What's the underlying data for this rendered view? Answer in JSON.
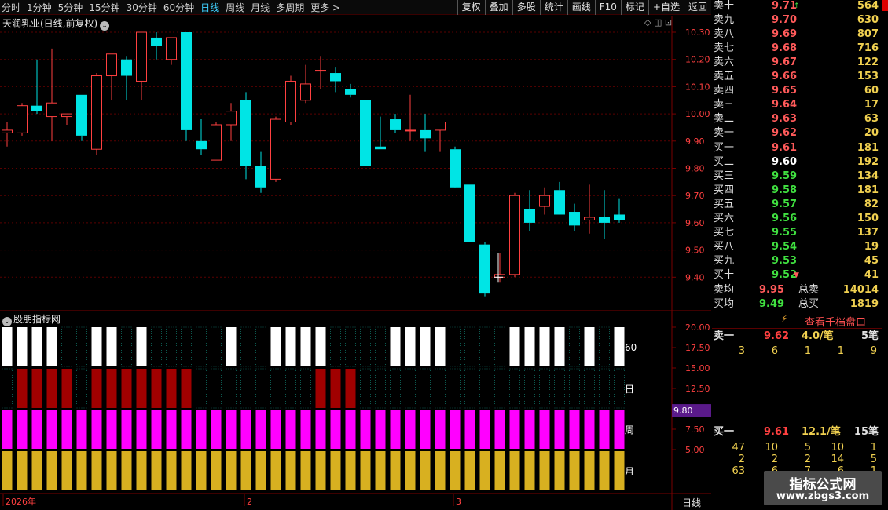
{
  "toolbar": {
    "periods": [
      "分时",
      "1分钟",
      "5分钟",
      "15分钟",
      "30分钟",
      "60分钟",
      "日线",
      "周线",
      "月线",
      "多周期",
      "更多 >"
    ],
    "active": "日线",
    "actions": [
      "复权",
      "叠加",
      "多股",
      "统计",
      "画线",
      "F10",
      "标记",
      "+自选",
      "返回"
    ]
  },
  "main_chart": {
    "title": "天润乳业(日线,前复权)",
    "tools": "◇ ◫ ⊡",
    "y_ticks": [
      "10.30",
      "10.20",
      "10.10",
      "10.00",
      "9.90",
      "9.80",
      "9.70",
      "9.60",
      "9.50",
      "9.40"
    ]
  },
  "indicator": {
    "title": "股朋指标网",
    "y_ticks": [
      "20.00",
      "17.50",
      "15.00",
      "12.50",
      "10.00",
      "7.50",
      "5.00"
    ],
    "row_labels": [
      "60",
      "日",
      "周",
      "月"
    ],
    "current_value": "9.80",
    "bottom_axis_label": "日线",
    "date_labels": [
      "2026年",
      "2",
      "3"
    ]
  },
  "chart_data": {
    "type": "candlestick",
    "title": "天润乳业(日线,前复权)",
    "ylim": [
      9.33,
      10.35
    ],
    "candles": [
      {
        "o": 9.93,
        "h": 9.97,
        "l": 9.88,
        "c": 9.94
      },
      {
        "o": 9.93,
        "h": 10.04,
        "l": 9.92,
        "c": 10.03
      },
      {
        "o": 10.03,
        "h": 10.2,
        "l": 10.0,
        "c": 10.01
      },
      {
        "o": 9.99,
        "h": 10.24,
        "l": 9.9,
        "c": 10.04
      },
      {
        "o": 9.99,
        "h": 10.0,
        "l": 9.96,
        "c": 10.0
      },
      {
        "o": 10.07,
        "h": 10.07,
        "l": 9.9,
        "c": 9.92
      },
      {
        "o": 9.87,
        "h": 10.15,
        "l": 9.85,
        "c": 10.14
      },
      {
        "o": 10.14,
        "h": 10.22,
        "l": 10.05,
        "c": 10.22
      },
      {
        "o": 10.2,
        "h": 10.21,
        "l": 10.05,
        "c": 10.14
      },
      {
        "o": 10.12,
        "h": 10.3,
        "l": 10.05,
        "c": 10.3
      },
      {
        "o": 10.28,
        "h": 10.3,
        "l": 10.2,
        "c": 10.25
      },
      {
        "o": 10.2,
        "h": 10.28,
        "l": 10.18,
        "c": 10.28
      },
      {
        "o": 10.3,
        "h": 10.3,
        "l": 9.9,
        "c": 9.94
      },
      {
        "o": 9.9,
        "h": 9.98,
        "l": 9.85,
        "c": 9.87
      },
      {
        "o": 9.83,
        "h": 9.97,
        "l": 9.83,
        "c": 9.96
      },
      {
        "o": 9.96,
        "h": 10.04,
        "l": 9.9,
        "c": 10.01
      },
      {
        "o": 10.05,
        "h": 10.08,
        "l": 9.76,
        "c": 9.81
      },
      {
        "o": 9.81,
        "h": 9.86,
        "l": 9.71,
        "c": 9.73
      },
      {
        "o": 9.76,
        "h": 9.99,
        "l": 9.75,
        "c": 9.98
      },
      {
        "o": 9.97,
        "h": 10.14,
        "l": 9.96,
        "c": 10.12
      },
      {
        "o": 10.05,
        "h": 10.18,
        "l": 10.04,
        "c": 10.11
      },
      {
        "o": 10.16,
        "h": 10.21,
        "l": 10.09,
        "c": 10.16
      },
      {
        "o": 10.15,
        "h": 10.17,
        "l": 10.08,
        "c": 10.12
      },
      {
        "o": 10.09,
        "h": 10.11,
        "l": 10.06,
        "c": 10.07
      },
      {
        "o": 10.05,
        "h": 10.05,
        "l": 9.81,
        "c": 9.81
      },
      {
        "o": 9.88,
        "h": 9.99,
        "l": 9.87,
        "c": 9.87
      },
      {
        "o": 9.98,
        "h": 10.0,
        "l": 9.93,
        "c": 9.94
      },
      {
        "o": 9.94,
        "h": 10.07,
        "l": 9.9,
        "c": 9.94
      },
      {
        "o": 9.94,
        "h": 10.0,
        "l": 9.86,
        "c": 9.91
      },
      {
        "o": 9.94,
        "h": 9.97,
        "l": 9.86,
        "c": 9.97
      },
      {
        "o": 9.87,
        "h": 9.88,
        "l": 9.75,
        "c": 9.73
      },
      {
        "o": 9.74,
        "h": 9.74,
        "l": 9.53,
        "c": 9.53
      },
      {
        "o": 9.52,
        "h": 9.53,
        "l": 9.33,
        "c": 9.34
      },
      {
        "o": 9.4,
        "h": 9.49,
        "l": 9.38,
        "c": 9.41
      },
      {
        "o": 9.41,
        "h": 9.71,
        "l": 9.4,
        "c": 9.7
      },
      {
        "o": 9.65,
        "h": 9.72,
        "l": 9.57,
        "c": 9.6
      },
      {
        "o": 9.66,
        "h": 9.73,
        "l": 9.63,
        "c": 9.7
      },
      {
        "o": 9.72,
        "h": 9.75,
        "l": 9.64,
        "c": 9.63
      },
      {
        "o": 9.64,
        "h": 9.67,
        "l": 9.57,
        "c": 9.59
      },
      {
        "o": 9.61,
        "h": 9.74,
        "l": 9.56,
        "c": 9.62
      },
      {
        "o": 9.62,
        "h": 9.72,
        "l": 9.54,
        "c": 9.6
      },
      {
        "o": 9.63,
        "h": 9.69,
        "l": 9.6,
        "c": 9.61
      }
    ],
    "indicator_rows": {
      "row_60_white": [
        1,
        1,
        1,
        1,
        0,
        0,
        1,
        1,
        0,
        1,
        0,
        0,
        0,
        0,
        0,
        1,
        0,
        0,
        1,
        1,
        1,
        1,
        0,
        0,
        0,
        0,
        1,
        1,
        1,
        1,
        0,
        0,
        0,
        0,
        1,
        1,
        1,
        1,
        0,
        1,
        0,
        1
      ],
      "row_day_red": [
        0,
        1,
        1,
        1,
        1,
        0,
        1,
        1,
        1,
        1,
        1,
        1,
        1,
        0,
        0,
        0,
        0,
        0,
        0,
        0,
        0,
        1,
        1,
        1,
        0,
        0,
        0,
        0,
        0,
        0,
        0,
        0,
        0,
        0,
        0,
        0,
        0,
        0,
        0,
        0,
        0,
        0
      ],
      "row_week_magenta": [
        1,
        1,
        1,
        1,
        1,
        1,
        1,
        1,
        1,
        1,
        1,
        1,
        1,
        1,
        1,
        1,
        1,
        1,
        1,
        1,
        1,
        1,
        1,
        1,
        1,
        1,
        1,
        1,
        1,
        1,
        1,
        1,
        1,
        1,
        1,
        1,
        1,
        1,
        1,
        1,
        1,
        1
      ],
      "row_month_gold": [
        1,
        1,
        1,
        1,
        1,
        1,
        1,
        1,
        1,
        1,
        1,
        1,
        1,
        1,
        1,
        1,
        1,
        1,
        1,
        1,
        1,
        1,
        1,
        1,
        1,
        1,
        1,
        1,
        1,
        1,
        1,
        1,
        1,
        1,
        1,
        1,
        1,
        1,
        1,
        1,
        1,
        1
      ]
    }
  },
  "orderbook": {
    "asks": [
      {
        "label": "卖十",
        "price": "9.71",
        "vol": "564",
        "mark": "↑"
      },
      {
        "label": "卖九",
        "price": "9.70",
        "vol": "630"
      },
      {
        "label": "卖八",
        "price": "9.69",
        "vol": "807"
      },
      {
        "label": "卖七",
        "price": "9.68",
        "vol": "716"
      },
      {
        "label": "卖六",
        "price": "9.67",
        "vol": "122"
      },
      {
        "label": "卖五",
        "price": "9.66",
        "vol": "153"
      },
      {
        "label": "卖四",
        "price": "9.65",
        "vol": "60"
      },
      {
        "label": "卖三",
        "price": "9.64",
        "vol": "17"
      },
      {
        "label": "卖二",
        "price": "9.63",
        "vol": "63"
      },
      {
        "label": "卖一",
        "price": "9.62",
        "vol": "20"
      }
    ],
    "bids": [
      {
        "label": "买一",
        "price": "9.61",
        "vol": "181",
        "cls": "up"
      },
      {
        "label": "买二",
        "price": "9.60",
        "vol": "192",
        "cls": "eq"
      },
      {
        "label": "买三",
        "price": "9.59",
        "vol": "134",
        "cls": "dn"
      },
      {
        "label": "买四",
        "price": "9.58",
        "vol": "181",
        "cls": "dn"
      },
      {
        "label": "买五",
        "price": "9.57",
        "vol": "82",
        "cls": "dn"
      },
      {
        "label": "买六",
        "price": "9.56",
        "vol": "150",
        "cls": "dn"
      },
      {
        "label": "买七",
        "price": "9.55",
        "vol": "137",
        "cls": "dn"
      },
      {
        "label": "买八",
        "price": "9.54",
        "vol": "19",
        "cls": "dn"
      },
      {
        "label": "买九",
        "price": "9.53",
        "vol": "45",
        "cls": "dn"
      },
      {
        "label": "买十",
        "price": "9.52",
        "vol": "41",
        "cls": "dn",
        "mark": "▼"
      }
    ],
    "avg_ask_label": "卖均",
    "avg_ask": "9.95",
    "total_ask_label": "总卖",
    "total_ask": "14014",
    "avg_bid_label": "买均",
    "avg_bid": "9.49",
    "total_bid_label": "总买",
    "total_bid": "1819",
    "depth_button": "查看千档盘口",
    "queue_ask": {
      "label": "卖一",
      "price": "9.62",
      "avg": "4.0/笔",
      "count": "5笔",
      "orders": [
        "3",
        "6",
        "1",
        "1",
        "9"
      ]
    },
    "queue_bid": {
      "label": "买一",
      "price": "9.61",
      "avg": "12.1/笔",
      "count": "15笔",
      "orders": [
        [
          "47",
          "10",
          "5",
          "10",
          "1"
        ],
        [
          "2",
          "2",
          "2",
          "14",
          "5"
        ],
        [
          "63",
          "6",
          "7",
          "6",
          "1"
        ]
      ]
    }
  },
  "watermark": {
    "line1": "指标公式网",
    "line2": "www.zbgs3.com"
  },
  "colors": {
    "up": "#ff4040",
    "down": "#00e5e5",
    "grid": "#5a0000",
    "white_bar": "#ffffff",
    "red_bar": "#a00000",
    "magenta_bar": "#ff00ff",
    "gold_bar": "#d8b020"
  }
}
